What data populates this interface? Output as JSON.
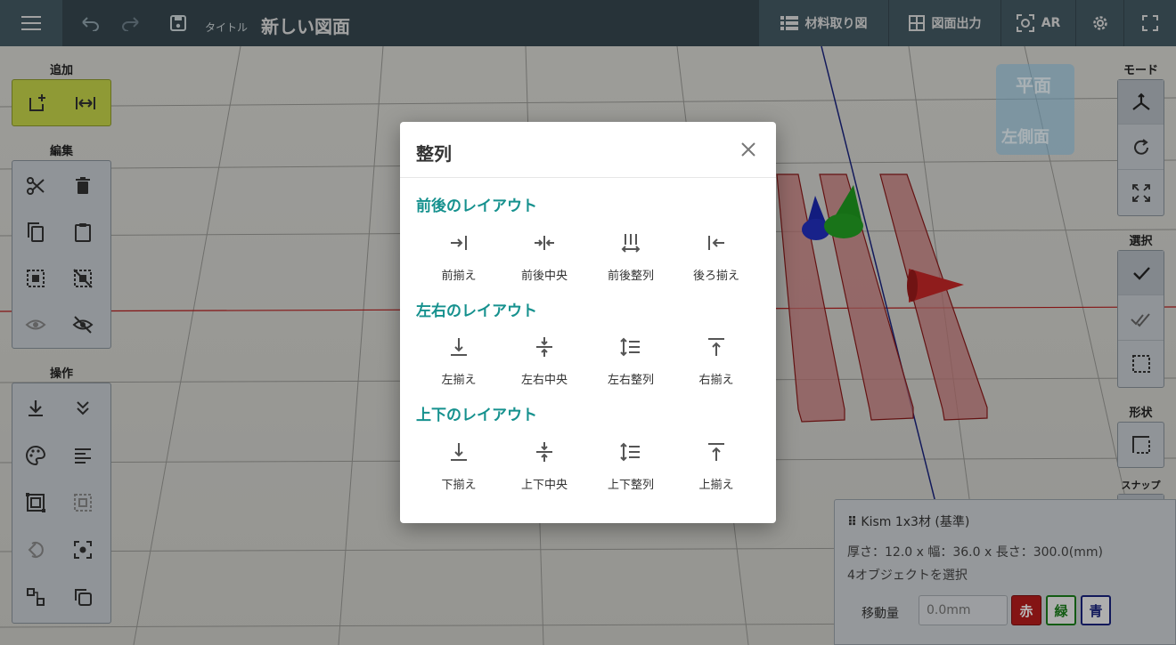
{
  "topbar": {
    "title_label": "タイトル",
    "title_value": "新しい図面",
    "buttons": [
      {
        "label": "材料取り図",
        "icon": "list-icon"
      },
      {
        "label": "図面出力",
        "icon": "grid-icon"
      },
      {
        "label": "AR",
        "icon": "ar-icon"
      }
    ]
  },
  "left_panel": {
    "add_label": "追加",
    "edit_label": "編集",
    "operate_label": "操作"
  },
  "right_panel": {
    "mode_label": "モード",
    "select_label": "選択",
    "shape_label": "形状",
    "snap_label": "スナップ"
  },
  "view_cube": {
    "top": "平面",
    "left": "左側面"
  },
  "modal": {
    "title": "整列",
    "sections": [
      {
        "title": "前後のレイアウト",
        "options": [
          {
            "label": "前揃え",
            "icon": "align-front-icon"
          },
          {
            "label": "前後中央",
            "icon": "center-front-back-icon"
          },
          {
            "label": "前後整列",
            "icon": "distribute-front-back-icon"
          },
          {
            "label": "後ろ揃え",
            "icon": "align-back-icon"
          }
        ]
      },
      {
        "title": "左右のレイアウト",
        "options": [
          {
            "label": "左揃え",
            "icon": "align-left-icon"
          },
          {
            "label": "左右中央",
            "icon": "center-left-right-icon"
          },
          {
            "label": "左右整列",
            "icon": "distribute-left-right-icon"
          },
          {
            "label": "右揃え",
            "icon": "align-right-icon"
          }
        ]
      },
      {
        "title": "上下のレイアウト",
        "options": [
          {
            "label": "下揃え",
            "icon": "align-bottom-icon"
          },
          {
            "label": "上下中央",
            "icon": "center-top-bottom-icon"
          },
          {
            "label": "上下整列",
            "icon": "distribute-top-bottom-icon"
          },
          {
            "label": "上揃え",
            "icon": "align-top-icon"
          }
        ]
      }
    ]
  },
  "info_panel": {
    "title": "Kism 1x3材 (基準)",
    "dimensions": "厚さ：12.0 x 幅：36.0 x 長さ：300.0(mm)",
    "selection": "4オブジェクトを選択",
    "move_label": "移動量",
    "move_placeholder": "0.0mm",
    "axis_red": "赤",
    "axis_green": "緑",
    "axis_blue": "青"
  },
  "colors": {
    "topbar": "#37474f",
    "accent": "#16918e",
    "add_panel": "#c6d64a",
    "red": "#b71c1c",
    "green": "#1b7f1b",
    "blue": "#1a237e"
  }
}
